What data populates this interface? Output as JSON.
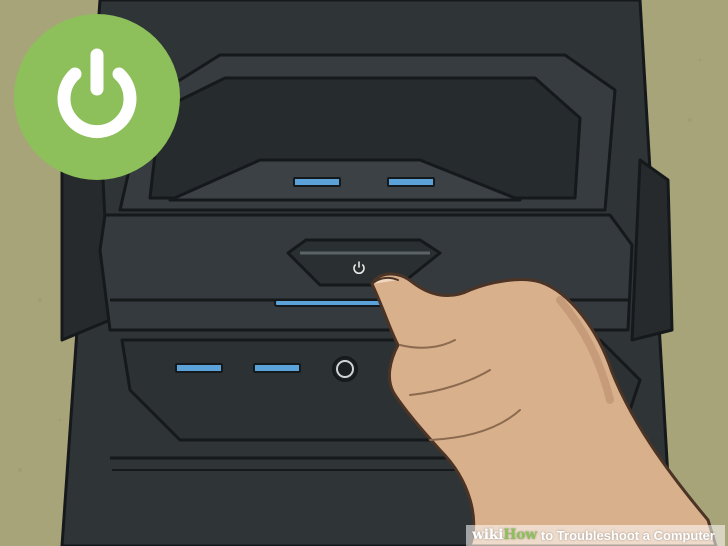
{
  "caption": {
    "brand_wiki": "wiki",
    "brand_how": "How",
    "title": "to Troubleshoot a Computer"
  },
  "colors": {
    "background": "#a8a47a",
    "case_dark": "#2f3437",
    "case_mid": "#3a4043",
    "case_outline": "#15191b",
    "usb_blue": "#5aa2d8",
    "power_badge": "#8dbf5a",
    "skin": "#d9b08c",
    "skin_shadow": "#b98d6d"
  },
  "icons": {
    "badge": "power-icon",
    "button": "power-icon",
    "audio_port": "audio-jack-icon"
  }
}
